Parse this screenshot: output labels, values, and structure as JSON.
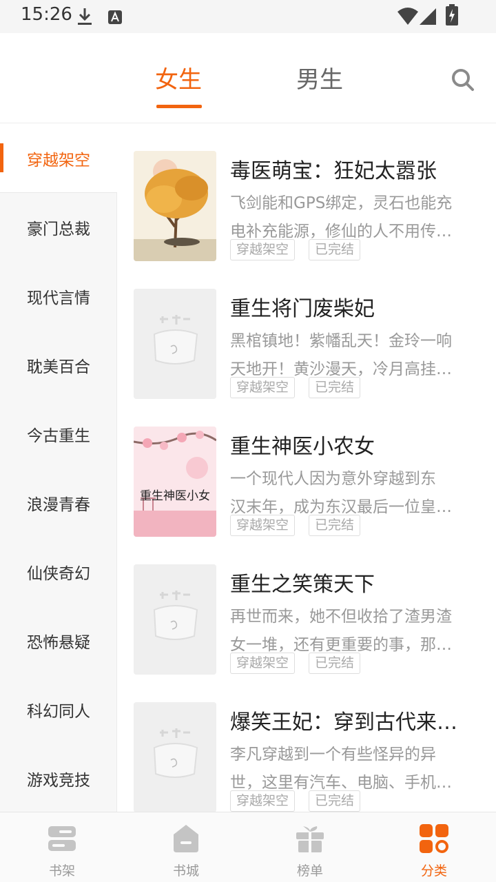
{
  "status_bar": {
    "time": "15:26"
  },
  "header": {
    "tabs": [
      {
        "label": "女生",
        "active": true
      },
      {
        "label": "男生",
        "active": false
      }
    ]
  },
  "sidebar": {
    "items": [
      {
        "label": "穿越架空",
        "active": true
      },
      {
        "label": "豪门总裁"
      },
      {
        "label": "现代言情"
      },
      {
        "label": "耽美百合"
      },
      {
        "label": "今古重生"
      },
      {
        "label": "浪漫青春"
      },
      {
        "label": "仙侠奇幻"
      },
      {
        "label": "恐怖悬疑"
      },
      {
        "label": "科幻同人"
      },
      {
        "label": "游戏竞技"
      }
    ]
  },
  "books": [
    {
      "title": "毒医萌宝：狂妃太嚣张",
      "desc_line1": "飞剑能和GPS绑定，灵石也能充",
      "desc_line2": "电补充能源，修仙的人不用传…",
      "tags": [
        "穿越架空",
        "已完结"
      ],
      "cover": "autumn-tree-cover"
    },
    {
      "title": "重生将门废柴妃",
      "desc_line1": "黑棺镇地！紫幡乱天！金玲一响",
      "desc_line2": "天地开！黄沙漫天，冷月高挂…",
      "tags": [
        "穿越架空",
        "已完结"
      ],
      "cover": "placeholder-cover"
    },
    {
      "title": "重生神医小农女",
      "desc_line1": "一个现代人因为意外穿越到东",
      "desc_line2": "汉末年，成为东汉最后一位皇…",
      "tags": [
        "穿越架空",
        "已完结"
      ],
      "cover": "pink-blossom-cover",
      "cover_text": "重生神医小女"
    },
    {
      "title": "重生之笑策天下",
      "desc_line1": "再世而来，她不但收拾了渣男渣",
      "desc_line2": "女一堆，还有更重要的事，那…",
      "tags": [
        "穿越架空",
        "已完结"
      ],
      "cover": "placeholder-cover"
    },
    {
      "title": "爆笑王妃：穿到古代来…",
      "desc_line1": "李凡穿越到一个有些怪异的异",
      "desc_line2": "世，这里有汽车、电脑、手机…",
      "tags": [
        "穿越架空",
        "已完结"
      ],
      "cover": "placeholder-cover"
    }
  ],
  "bottom_nav": {
    "items": [
      {
        "label": "书架",
        "icon": "bookshelf-icon"
      },
      {
        "label": "书城",
        "icon": "bookstore-icon"
      },
      {
        "label": "榜单",
        "icon": "gift-ranking-icon"
      },
      {
        "label": "分类",
        "icon": "category-grid-icon",
        "active": true
      }
    ]
  },
  "colors": {
    "accent": "#f2640f",
    "muted": "#9a9a9a"
  }
}
